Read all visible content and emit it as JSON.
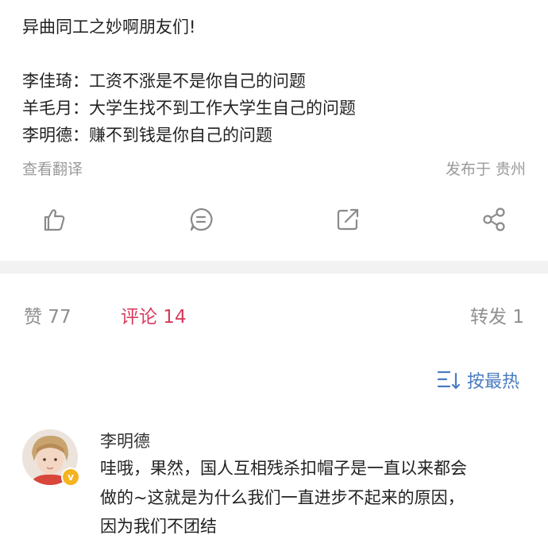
{
  "post": {
    "lines": [
      "异曲同工之妙啊朋友们!",
      "李佳琦：工资不涨是不是你自己的问题",
      "羊毛月：大学生找不到工作大学生自己的问题",
      "李明德：赚不到钱是你自己的问题"
    ],
    "translate_label": "查看翻译",
    "location_label": "发布于 贵州"
  },
  "actions": [
    {
      "icon": "like-icon"
    },
    {
      "icon": "comment-icon"
    },
    {
      "icon": "repost-icon"
    },
    {
      "icon": "share-icon"
    }
  ],
  "tabs": {
    "likes": "赞 77",
    "comments": "评论 14",
    "reposts": "转发 1"
  },
  "sort": {
    "label": "按最热",
    "icon": "sort-icon"
  },
  "comment": {
    "author": "李明德",
    "badge_icon": "verified-badge-icon",
    "lines": [
      "哇哦，果然，国人互相残杀扣帽子是一直以来都会",
      "做的~这就是为什么我们一直进步不起来的原因，",
      "因为我们不团结"
    ]
  },
  "colors": {
    "accent": "#d83b5e",
    "link": "#4a7cc0",
    "muted": "#9a9a9a",
    "divider": "#f2f2f2"
  }
}
